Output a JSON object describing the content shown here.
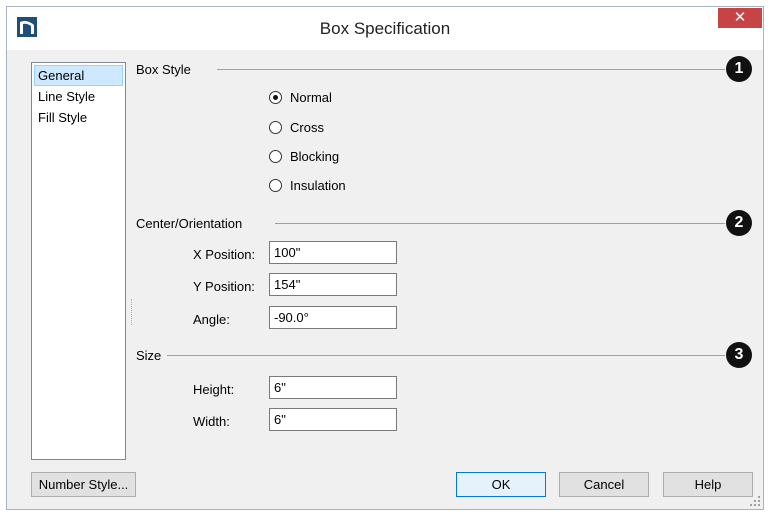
{
  "window": {
    "title": "Box Specification",
    "close_glyph": "✕",
    "app_icon": "chief-architect-logo-icon"
  },
  "nav": {
    "items": [
      {
        "label": "General",
        "selected": true
      },
      {
        "label": "Line Style",
        "selected": false
      },
      {
        "label": "Fill Style",
        "selected": false
      }
    ]
  },
  "box_style": {
    "title": "Box Style",
    "badge": "1",
    "options": [
      {
        "label": "Normal",
        "checked": true
      },
      {
        "label": "Cross",
        "checked": false
      },
      {
        "label": "Blocking",
        "checked": false
      },
      {
        "label": "Insulation",
        "checked": false
      }
    ]
  },
  "center": {
    "title": "Center/Orientation",
    "badge": "2",
    "x_label": "X Position:",
    "x_value": "100\"",
    "y_label": "Y Position:",
    "y_value": "154\"",
    "angle_label": "Angle:",
    "angle_value": "-90.0°"
  },
  "size": {
    "title": "Size",
    "badge": "3",
    "height_label": "Height:",
    "height_value": "6\"",
    "width_label": "Width:",
    "width_value": "6\""
  },
  "buttons": {
    "number_style": "Number Style...",
    "ok": "OK",
    "cancel": "Cancel",
    "help": "Help"
  },
  "colors": {
    "close_bg": "#c74446",
    "selected_bg": "#cde8ff",
    "default_button_border": "#0078d7"
  }
}
